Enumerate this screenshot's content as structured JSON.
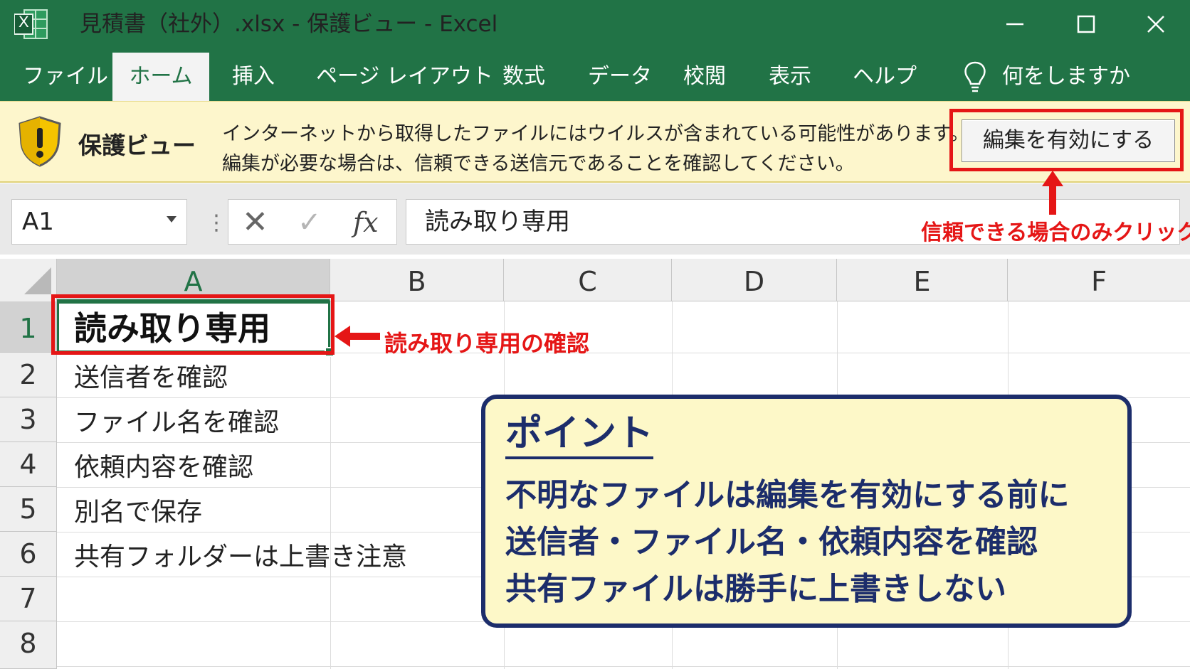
{
  "window": {
    "app_icon_letter": "X",
    "title": "見積書（社外）.xlsx  -  保護ビュー  -  Excel"
  },
  "ribbon": {
    "tabs": [
      {
        "label": "ファイル"
      },
      {
        "label": "ホーム"
      },
      {
        "label": "挿入"
      },
      {
        "label": "ページ レイアウト"
      },
      {
        "label": "数式"
      },
      {
        "label": "データ"
      },
      {
        "label": "校閲"
      },
      {
        "label": "表示"
      },
      {
        "label": "ヘルプ"
      }
    ],
    "active_tab": "ホーム",
    "tell_me": "何をしますか"
  },
  "protected_view": {
    "title": "保護ビュー",
    "message_line1": "インターネットから取得したファイルにはウイルスが含まれている可能性があります。",
    "message_line2": "編集が必要な場合は、信頼できる送信元であることを確認してください。",
    "enable_button": "編集を有効にする"
  },
  "formula_bar": {
    "name_box": "A1",
    "fx": "fx",
    "content": "読み取り専用"
  },
  "annotations": {
    "enable_note": "信頼できる場合のみクリック",
    "a1_note": "読み取り専用の確認"
  },
  "sheet": {
    "columns": [
      "A",
      "B",
      "C",
      "D",
      "E",
      "F"
    ],
    "rows": [
      "1",
      "2",
      "3",
      "4",
      "5",
      "6",
      "7",
      "8"
    ],
    "selected_cell": "A1",
    "cells": {
      "A1": "読み取り専用",
      "A2": "送信者を確認",
      "A3": "ファイル名を確認",
      "A4": "依頼内容を確認",
      "A5": "別名で保存",
      "A6": "共有フォルダーは上書き注意"
    }
  },
  "point": {
    "title": "ポイント",
    "lines": [
      "不明なファイルは編集を有効にする前に",
      "送信者・ファイル名・依頼内容を確認",
      "共有ファイルは勝手に上書きしない"
    ]
  },
  "colors": {
    "excel_green": "#217346",
    "protected_bar": "#fdf6cc",
    "annotation_red": "#e51616",
    "point_navy": "#1c2d6b",
    "point_bg": "#fdf8c8"
  },
  "icons": {
    "app": "excel-app-icon",
    "minimize": "minimize-icon",
    "maximize": "maximize-icon",
    "close": "close-icon",
    "tell_me": "lightbulb-icon",
    "warning": "warning-shield-icon"
  }
}
